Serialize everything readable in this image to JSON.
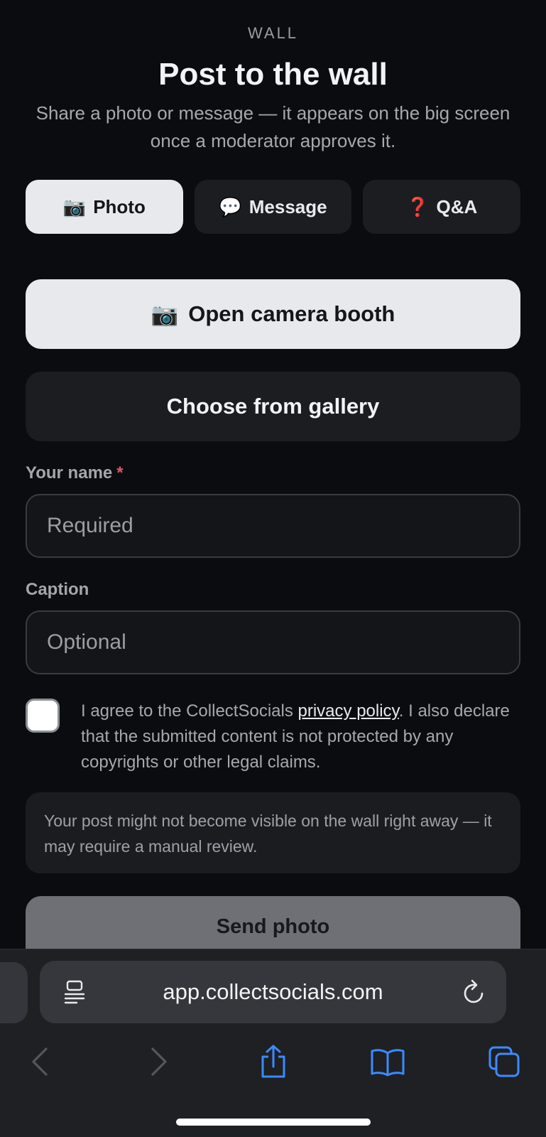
{
  "header": {
    "eyebrow": "WALL",
    "title": "Post to the wall",
    "subtitle": "Share a photo or message — it appears on the big screen once a moderator approves it."
  },
  "tabs": [
    {
      "emoji": "📷",
      "label": "Photo",
      "active": true
    },
    {
      "emoji": "💬",
      "label": "Message",
      "active": false
    },
    {
      "emoji": "❓",
      "label": "Q&A",
      "active": false
    }
  ],
  "actions": {
    "camera_emoji": "📷",
    "camera_label": "Open camera booth",
    "gallery_label": "Choose from gallery"
  },
  "form": {
    "name_label": "Your name",
    "name_required_mark": "*",
    "name_placeholder": "Required",
    "caption_label": "Caption",
    "caption_placeholder": "Optional"
  },
  "consent": {
    "text_before": "I agree to the CollectSocials ",
    "link_text": "privacy policy",
    "text_after": ". I also declare that the submitted content is not protected by any copyrights or other legal claims.",
    "checked": false
  },
  "notice": {
    "text": "Your post might not become visible on the wall right away — it may require a manual review."
  },
  "submit": {
    "label": "Send photo"
  },
  "browser": {
    "url": "app.collectsocials.com"
  },
  "colors": {
    "background": "#0b0c0f",
    "accent_link": "#3b8bff",
    "required": "#e0566b"
  },
  "icons": [
    "reader-mode-icon",
    "reload-icon",
    "back-arrow-icon",
    "forward-arrow-icon",
    "share-icon",
    "bookmarks-icon",
    "tabs-icon"
  ]
}
